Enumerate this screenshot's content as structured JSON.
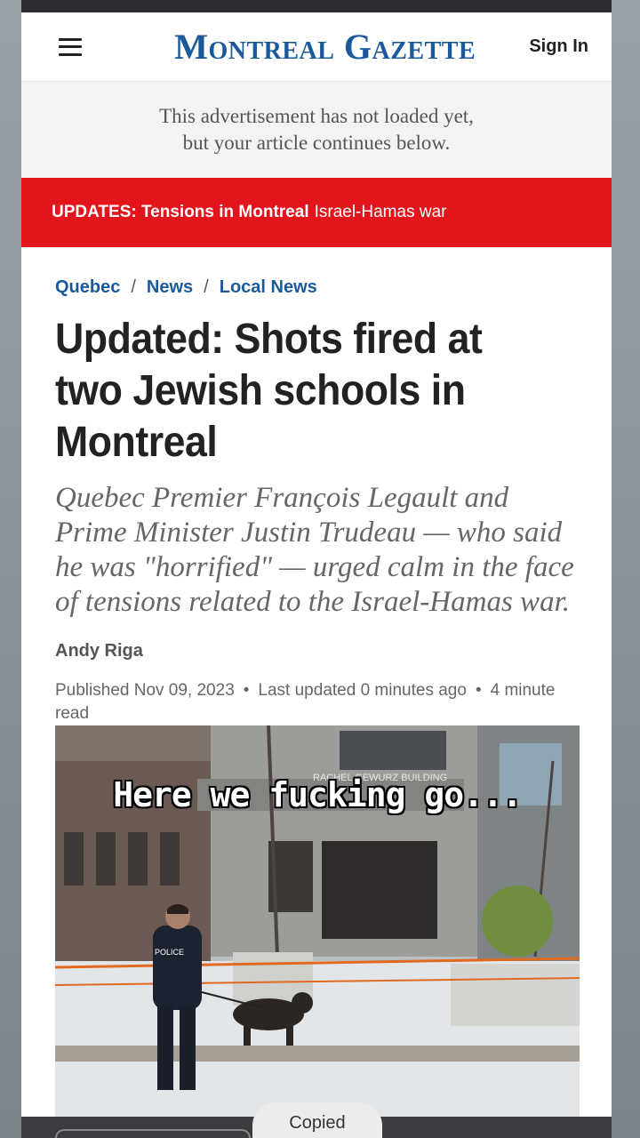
{
  "header": {
    "logo": "Montreal Gazette",
    "sign_in": "Sign In"
  },
  "ad": {
    "line1": "This advertisement has not loaded yet,",
    "line2": "but your article continues below."
  },
  "updates": {
    "label": "UPDATES: Tensions in Montreal",
    "topic": "Israel-Hamas war"
  },
  "breadcrumb": [
    "Quebec",
    "News",
    "Local News"
  ],
  "article": {
    "headline": "Updated: Shots fired at two Jewish schools in Montreal",
    "dek": "Quebec Premier François Legault and Prime Minister Justin Trudeau — who said he was \"horrified\" — urged calm in the face of tensions related to the Israel-Hamas war.",
    "author": "Andy Riga",
    "published": "Published Nov 09, 2023",
    "updated": "Last updated 0 minutes ago",
    "read_time": "4 minute read"
  },
  "photo": {
    "overlay_caption": "Here we fucking go...",
    "sign_text": "RACHEL GEWURZ BUILDING",
    "police_patch": "POLICE"
  },
  "toast": {
    "text": "Copied"
  },
  "colors": {
    "brand_blue": "#1a5a9c",
    "updates_red": "#e3141c"
  }
}
